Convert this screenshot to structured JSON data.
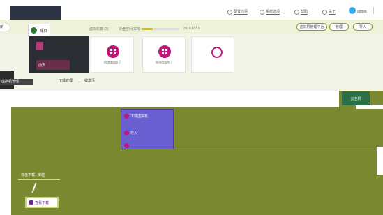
{
  "window": {
    "title_blurred": true
  },
  "topbar": {
    "links": [
      {
        "label": "配置向导",
        "icon": "settings-icon"
      },
      {
        "label": "系统选项",
        "icon": "options-icon"
      },
      {
        "label": "帮助",
        "icon": "help-icon"
      },
      {
        "label": "关于",
        "icon": "info-icon"
      }
    ],
    "user": "admin"
  },
  "header": {
    "left_tag": "新",
    "home_label": "首页",
    "stat_vm_count": "虚拟机数 (3)",
    "stat_capacity": "硬盘空间(GB):",
    "capacity_value": "39.7/137.0",
    "capacity_progress": 0.29,
    "pills": [
      "虚拟机管理平台",
      "管理",
      "导入"
    ]
  },
  "nav": {
    "items": [
      {
        "label": "前页"
      }
    ]
  },
  "vm_cards": [
    {
      "label": "Windows 7",
      "icon": "windows-icon"
    },
    {
      "label": "Windows 7",
      "icon": "windows-icon"
    },
    {
      "label": "",
      "icon": "add-icon"
    }
  ],
  "sidebar": {
    "label": "虚拟机管理"
  },
  "toolbar": {
    "items": [
      "下载管理",
      "一键激活"
    ]
  },
  "vmachine_button": {
    "label": "云主机"
  },
  "menu": {
    "items": [
      {
        "label": "下载虚拟机",
        "icon": "download-icon"
      },
      {
        "label": "导入",
        "icon": "import-icon"
      },
      {
        "label": "",
        "icon": "more-icon"
      }
    ]
  },
  "download": {
    "hint": "双击下载...安装",
    "button_label": "查看下载"
  },
  "colors": {
    "accent_green": "#7a8930",
    "brand_magenta": "#c2177a",
    "menu_purple": "#6a5fd0",
    "band_green": "#f3f5e8"
  }
}
